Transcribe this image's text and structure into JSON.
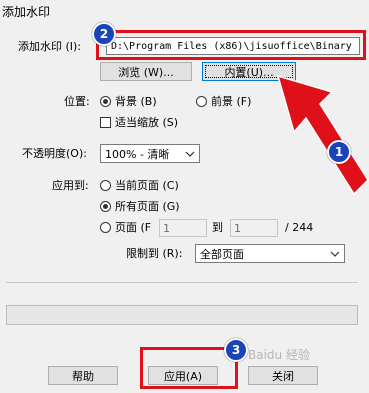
{
  "window": {
    "title": "添加水印"
  },
  "watermark_row": {
    "label": "添加水印 (I):",
    "path_value": "D:\\Program Files (x86)\\jisuoffice\\Binary",
    "browse_label": "浏览 (W)...",
    "builtin_label": "内置(U)..."
  },
  "position": {
    "label": "位置:",
    "background_label": "背景 (B)",
    "foreground_label": "前景 (F)",
    "scale_label": "适当缩放 (S)"
  },
  "opacity": {
    "label": "不透明度(O):",
    "value": "100% - 清晰"
  },
  "apply_to": {
    "label": "应用到:",
    "current_page_label": "当前页面 (C)",
    "all_pages_label": "所有页面 (G)",
    "pages_label": "页面 (F",
    "from_value": "1",
    "to_label": "到",
    "to_value": "1",
    "total_label": "/ 244",
    "limit_label": "限制到 (R):",
    "limit_value": "全部页面"
  },
  "footer": {
    "help_label": "帮助",
    "apply_label": "应用(A)",
    "close_label": "关闭"
  },
  "annotations": {
    "badge_1": "1",
    "badge_2": "2",
    "badge_3": "3",
    "accent_red": "#e0101a",
    "accent_blue": "#1a44b8"
  },
  "watermark_overlay": {
    "text": "Baidu 经验"
  }
}
